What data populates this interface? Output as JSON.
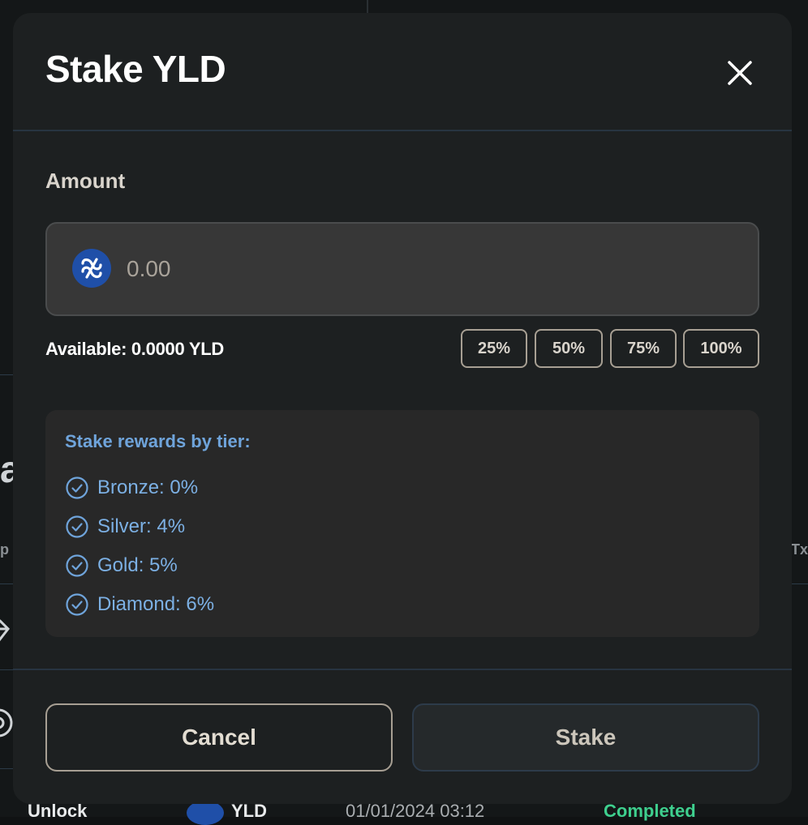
{
  "background": {
    "row": {
      "type": "Unlock",
      "token": "YLD",
      "date": "01/01/2024 03:12",
      "status": "Completed"
    },
    "fragments": {
      "big": "a",
      "left_header": "p",
      "right_header": "Tx"
    }
  },
  "modal": {
    "title": "Stake YLD",
    "close_icon": "close-icon",
    "amount": {
      "label": "Amount",
      "value": "",
      "placeholder": "0.00",
      "token_icon": "yld-token-icon"
    },
    "available": "Available: 0.0000 YLD",
    "percent_buttons": [
      "25%",
      "50%",
      "75%",
      "100%"
    ],
    "rewards": {
      "title": "Stake rewards by tier:",
      "tiers": [
        {
          "label": "Bronze: 0%"
        },
        {
          "label": "Silver: 4%"
        },
        {
          "label": "Gold: 5%"
        },
        {
          "label": "Diamond: 6%"
        }
      ]
    },
    "actions": {
      "cancel_label": "Cancel",
      "stake_label": "Stake"
    }
  },
  "colors": {
    "modal_bg": "#1d2021",
    "accent_blue": "#6fa4db",
    "token_blue": "#1f4fa8",
    "border_tan": "#a79f93",
    "completed_green": "#3ecf8e"
  }
}
